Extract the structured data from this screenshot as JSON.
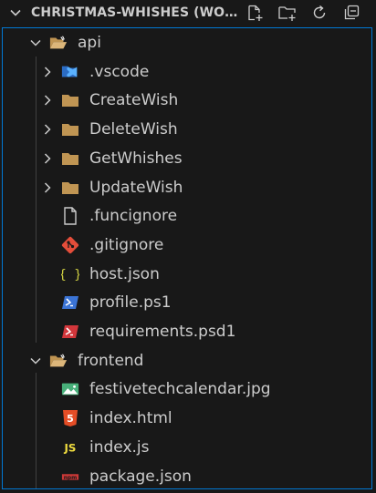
{
  "explorer": {
    "section_title": "CHRISTMAS-WHISHES (WOR...",
    "actions": [
      {
        "name": "new-file",
        "icon": "new-file-icon"
      },
      {
        "name": "new-folder",
        "icon": "new-folder-icon"
      },
      {
        "name": "refresh",
        "icon": "refresh-icon"
      },
      {
        "name": "collapse-all",
        "icon": "collapse-all-icon"
      }
    ],
    "tree": [
      {
        "label": "api",
        "kind": "folder",
        "expanded": true,
        "icon": "open-folder-icon"
      },
      {
        "label": ".vscode",
        "kind": "folder",
        "expanded": false,
        "icon": "vscode-folder-icon"
      },
      {
        "label": "CreateWish",
        "kind": "folder",
        "expanded": false,
        "icon": "folder-icon"
      },
      {
        "label": "DeleteWish",
        "kind": "folder",
        "expanded": false,
        "icon": "folder-icon"
      },
      {
        "label": "GetWhishes",
        "kind": "folder",
        "expanded": false,
        "icon": "folder-icon"
      },
      {
        "label": "UpdateWish",
        "kind": "folder",
        "expanded": false,
        "icon": "folder-icon"
      },
      {
        "label": ".funcignore",
        "kind": "file",
        "icon": "file-icon"
      },
      {
        "label": ".gitignore",
        "kind": "file",
        "icon": "git-icon"
      },
      {
        "label": "host.json",
        "kind": "file",
        "icon": "json-icon"
      },
      {
        "label": "profile.ps1",
        "kind": "file",
        "icon": "powershell-icon"
      },
      {
        "label": "requirements.psd1",
        "kind": "file",
        "icon": "powershell-data-icon"
      },
      {
        "label": "frontend",
        "kind": "folder",
        "expanded": true,
        "icon": "open-folder-icon"
      },
      {
        "label": "festivetechcalendar.jpg",
        "kind": "file",
        "icon": "image-icon"
      },
      {
        "label": "index.html",
        "kind": "file",
        "icon": "html5-icon"
      },
      {
        "label": "index.js",
        "kind": "file",
        "icon": "javascript-icon"
      },
      {
        "label": "package.json",
        "kind": "file",
        "icon": "npm-icon"
      }
    ],
    "colors": {
      "background": "#181818",
      "focus_border": "#0078d4",
      "text": "#cccccc",
      "folder": "#c09553",
      "vscode_blue": "#3794ff",
      "json_yellow": "#cbcb41",
      "git_red": "#e44d3a",
      "powershell_blue": "#3b74d6",
      "psd_red": "#d2363b",
      "image_green": "#48b07a",
      "html_orange": "#e44d26",
      "js_yellow": "#f1dd3f",
      "npm_red": "#cb3837"
    }
  }
}
